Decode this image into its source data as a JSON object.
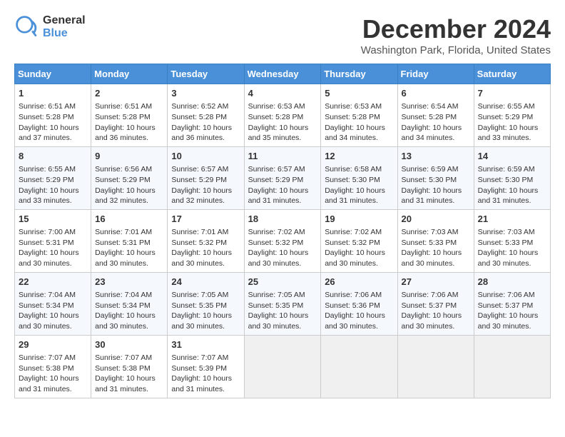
{
  "header": {
    "logo_line1": "General",
    "logo_line2": "Blue",
    "month": "December 2024",
    "location": "Washington Park, Florida, United States"
  },
  "weekdays": [
    "Sunday",
    "Monday",
    "Tuesday",
    "Wednesday",
    "Thursday",
    "Friday",
    "Saturday"
  ],
  "weeks": [
    [
      {
        "day": "1",
        "info": "Sunrise: 6:51 AM\nSunset: 5:28 PM\nDaylight: 10 hours\nand 37 minutes."
      },
      {
        "day": "2",
        "info": "Sunrise: 6:51 AM\nSunset: 5:28 PM\nDaylight: 10 hours\nand 36 minutes."
      },
      {
        "day": "3",
        "info": "Sunrise: 6:52 AM\nSunset: 5:28 PM\nDaylight: 10 hours\nand 36 minutes."
      },
      {
        "day": "4",
        "info": "Sunrise: 6:53 AM\nSunset: 5:28 PM\nDaylight: 10 hours\nand 35 minutes."
      },
      {
        "day": "5",
        "info": "Sunrise: 6:53 AM\nSunset: 5:28 PM\nDaylight: 10 hours\nand 34 minutes."
      },
      {
        "day": "6",
        "info": "Sunrise: 6:54 AM\nSunset: 5:28 PM\nDaylight: 10 hours\nand 34 minutes."
      },
      {
        "day": "7",
        "info": "Sunrise: 6:55 AM\nSunset: 5:29 PM\nDaylight: 10 hours\nand 33 minutes."
      }
    ],
    [
      {
        "day": "8",
        "info": "Sunrise: 6:55 AM\nSunset: 5:29 PM\nDaylight: 10 hours\nand 33 minutes."
      },
      {
        "day": "9",
        "info": "Sunrise: 6:56 AM\nSunset: 5:29 PM\nDaylight: 10 hours\nand 32 minutes."
      },
      {
        "day": "10",
        "info": "Sunrise: 6:57 AM\nSunset: 5:29 PM\nDaylight: 10 hours\nand 32 minutes."
      },
      {
        "day": "11",
        "info": "Sunrise: 6:57 AM\nSunset: 5:29 PM\nDaylight: 10 hours\nand 31 minutes."
      },
      {
        "day": "12",
        "info": "Sunrise: 6:58 AM\nSunset: 5:30 PM\nDaylight: 10 hours\nand 31 minutes."
      },
      {
        "day": "13",
        "info": "Sunrise: 6:59 AM\nSunset: 5:30 PM\nDaylight: 10 hours\nand 31 minutes."
      },
      {
        "day": "14",
        "info": "Sunrise: 6:59 AM\nSunset: 5:30 PM\nDaylight: 10 hours\nand 31 minutes."
      }
    ],
    [
      {
        "day": "15",
        "info": "Sunrise: 7:00 AM\nSunset: 5:31 PM\nDaylight: 10 hours\nand 30 minutes."
      },
      {
        "day": "16",
        "info": "Sunrise: 7:01 AM\nSunset: 5:31 PM\nDaylight: 10 hours\nand 30 minutes."
      },
      {
        "day": "17",
        "info": "Sunrise: 7:01 AM\nSunset: 5:32 PM\nDaylight: 10 hours\nand 30 minutes."
      },
      {
        "day": "18",
        "info": "Sunrise: 7:02 AM\nSunset: 5:32 PM\nDaylight: 10 hours\nand 30 minutes."
      },
      {
        "day": "19",
        "info": "Sunrise: 7:02 AM\nSunset: 5:32 PM\nDaylight: 10 hours\nand 30 minutes."
      },
      {
        "day": "20",
        "info": "Sunrise: 7:03 AM\nSunset: 5:33 PM\nDaylight: 10 hours\nand 30 minutes."
      },
      {
        "day": "21",
        "info": "Sunrise: 7:03 AM\nSunset: 5:33 PM\nDaylight: 10 hours\nand 30 minutes."
      }
    ],
    [
      {
        "day": "22",
        "info": "Sunrise: 7:04 AM\nSunset: 5:34 PM\nDaylight: 10 hours\nand 30 minutes."
      },
      {
        "day": "23",
        "info": "Sunrise: 7:04 AM\nSunset: 5:34 PM\nDaylight: 10 hours\nand 30 minutes."
      },
      {
        "day": "24",
        "info": "Sunrise: 7:05 AM\nSunset: 5:35 PM\nDaylight: 10 hours\nand 30 minutes."
      },
      {
        "day": "25",
        "info": "Sunrise: 7:05 AM\nSunset: 5:35 PM\nDaylight: 10 hours\nand 30 minutes."
      },
      {
        "day": "26",
        "info": "Sunrise: 7:06 AM\nSunset: 5:36 PM\nDaylight: 10 hours\nand 30 minutes."
      },
      {
        "day": "27",
        "info": "Sunrise: 7:06 AM\nSunset: 5:37 PM\nDaylight: 10 hours\nand 30 minutes."
      },
      {
        "day": "28",
        "info": "Sunrise: 7:06 AM\nSunset: 5:37 PM\nDaylight: 10 hours\nand 30 minutes."
      }
    ],
    [
      {
        "day": "29",
        "info": "Sunrise: 7:07 AM\nSunset: 5:38 PM\nDaylight: 10 hours\nand 31 minutes."
      },
      {
        "day": "30",
        "info": "Sunrise: 7:07 AM\nSunset: 5:38 PM\nDaylight: 10 hours\nand 31 minutes."
      },
      {
        "day": "31",
        "info": "Sunrise: 7:07 AM\nSunset: 5:39 PM\nDaylight: 10 hours\nand 31 minutes."
      },
      {
        "day": "",
        "info": ""
      },
      {
        "day": "",
        "info": ""
      },
      {
        "day": "",
        "info": ""
      },
      {
        "day": "",
        "info": ""
      }
    ]
  ]
}
